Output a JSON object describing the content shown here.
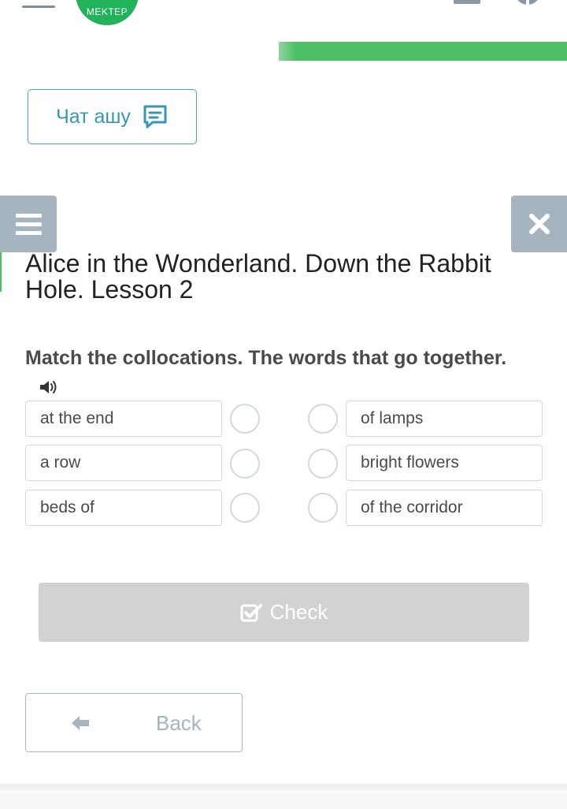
{
  "header": {
    "logo_text": "MEKTEP",
    "progress_fraction": 1.0
  },
  "chat": {
    "label": "Чат ашу",
    "icon": "chat-icon"
  },
  "lesson": {
    "title": "Alice in the Wonderland. Down the Rabbit Hole. Lesson 2"
  },
  "task": {
    "instruction": "Match the collocations. The words that go together.",
    "audio_icon": "speaker-icon"
  },
  "left_items": [
    {
      "label": "at the end"
    },
    {
      "label": "a row"
    },
    {
      "label": "beds of"
    }
  ],
  "right_items": [
    {
      "label": "of lamps"
    },
    {
      "label": "bright flowers"
    },
    {
      "label": "of the corridor"
    }
  ],
  "buttons": {
    "check_label": "Check",
    "check_icon": "check-square-icon",
    "back_label": "Back",
    "back_icon": "arrow-left-icon",
    "menu_icon": "menu-icon",
    "close_icon": "close-icon"
  },
  "colors": {
    "accent_green": "#4cc066",
    "chat_blue": "#3597b8",
    "side_button_grey": "#a5b4bf",
    "check_disabled": "#d2d2d2"
  }
}
